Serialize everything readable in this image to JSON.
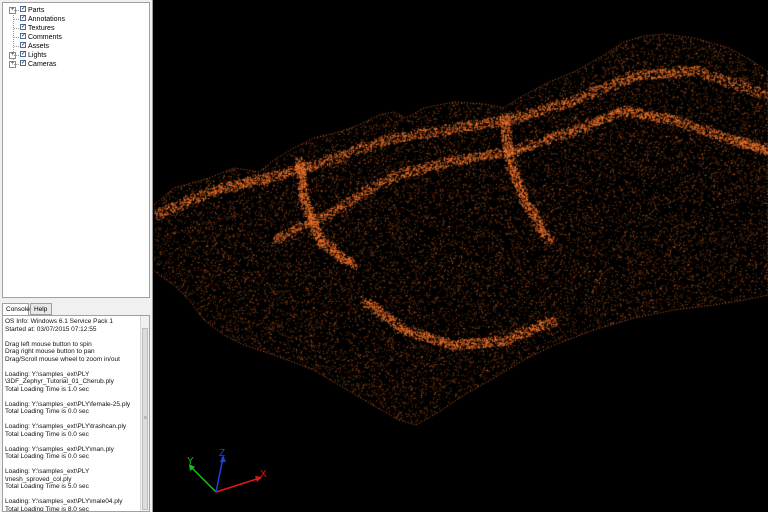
{
  "scene_tree": {
    "items": [
      {
        "label": "Parts",
        "expandable": true,
        "checked": true
      },
      {
        "label": "Annotations",
        "expandable": false,
        "checked": true
      },
      {
        "label": "Textures",
        "expandable": false,
        "checked": true
      },
      {
        "label": "Comments",
        "expandable": false,
        "checked": true
      },
      {
        "label": "Assets",
        "expandable": false,
        "checked": true
      },
      {
        "label": "Lights",
        "expandable": true,
        "checked": true
      },
      {
        "label": "Cameras",
        "expandable": true,
        "checked": true
      }
    ]
  },
  "tabs": {
    "console": "Console",
    "help": "Help"
  },
  "console": {
    "log": "OS Info: Windows 6.1 Service Pack 1\nStarted at: 03/07/2015 07:12:55\n\nDrag left mouse button to spin\nDrag right mouse button to pan\nDrag/Scroll mouse wheel to zoom in/out\n\nLoading: Y:\\samples_ext\\PLY\n\\3DF_Zephyr_Tutorial_01_Cherub.ply\nTotal Loading Time is 1.0 sec\n\nLoading: Y:\\samples_ext\\PLY\\female-25.ply\nTotal Loading Time is 0.0 sec\n\nLoading: Y:\\samples_ext\\PLY\\trashcan.ply\nTotal Loading Time is 0.0 sec\n\nLoading: Y:\\samples_ext\\PLY\\man.ply\nTotal Loading Time is 0.0 sec\n\nLoading: Y:\\samples_ext\\PLY\n\\mesh_sproved_col.ply\nTotal Loading Time is 5.0 sec\n\nLoading: Y:\\samples_ext\\PLY\\male04.ply\nTotal Loading Time is 8.0 sec"
  },
  "axes": {
    "x": "X",
    "y": "Y",
    "z": "Z"
  },
  "colors": {
    "point_cloud": "#ff7a2e",
    "background": "#000000",
    "axis_x": "#e01818",
    "axis_y": "#18c018",
    "axis_z": "#2040e0"
  }
}
